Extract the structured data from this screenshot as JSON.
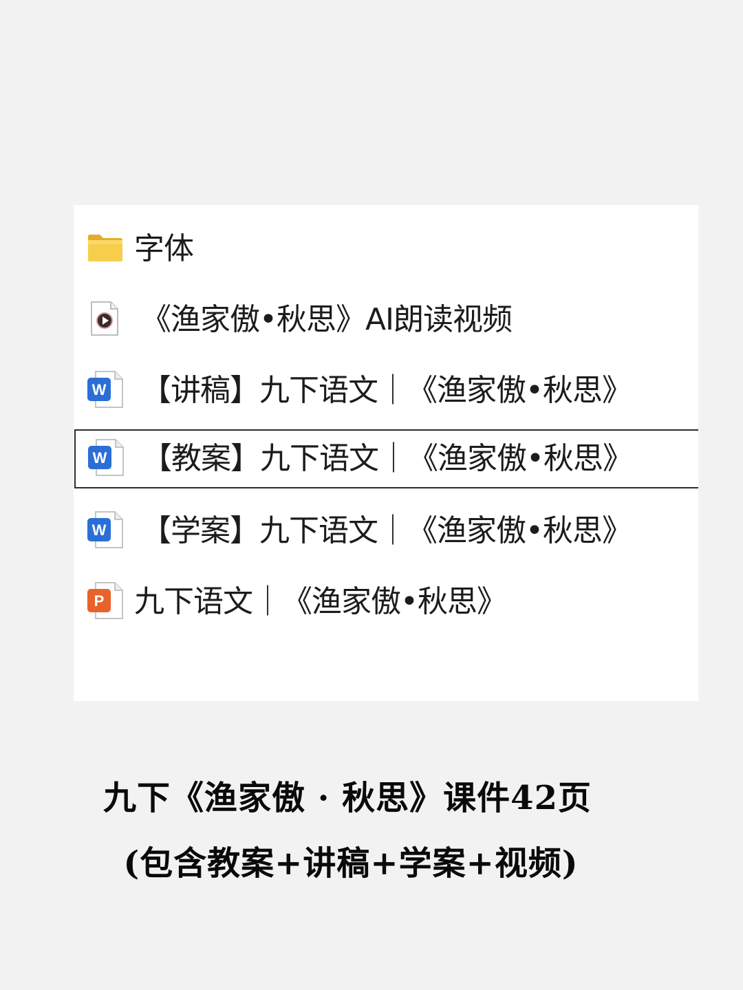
{
  "files": [
    {
      "name": "字体",
      "type": "folder",
      "icon": "folder-icon",
      "selected": false
    },
    {
      "name": "《渔家傲•秋思》AI朗读视频",
      "type": "video",
      "icon": "video-file-icon",
      "selected": false
    },
    {
      "name": "【讲稿】九下语文｜《渔家傲•秋思》",
      "type": "word",
      "icon": "word-doc-icon",
      "selected": false
    },
    {
      "name": "【教案】九下语文｜《渔家傲•秋思》",
      "type": "word",
      "icon": "word-doc-icon",
      "selected": true
    },
    {
      "name": "【学案】九下语文｜《渔家傲•秋思》",
      "type": "word",
      "icon": "word-doc-icon",
      "selected": false
    },
    {
      "name": "九下语文｜《渔家傲•秋思》",
      "type": "powerpoint",
      "icon": "powerpoint-doc-icon",
      "selected": false
    }
  ],
  "caption": {
    "line1": "九下《渔家傲 · 秋思》课件42页",
    "line2": "(包含教案+讲稿+学案+视频)"
  },
  "colors": {
    "background": "#f2f2f2",
    "panel": "#ffffff",
    "folder": "#f5c842",
    "word": "#2b6fd6",
    "powerpoint": "#e8622a",
    "video_play": "#3a2a2a"
  }
}
